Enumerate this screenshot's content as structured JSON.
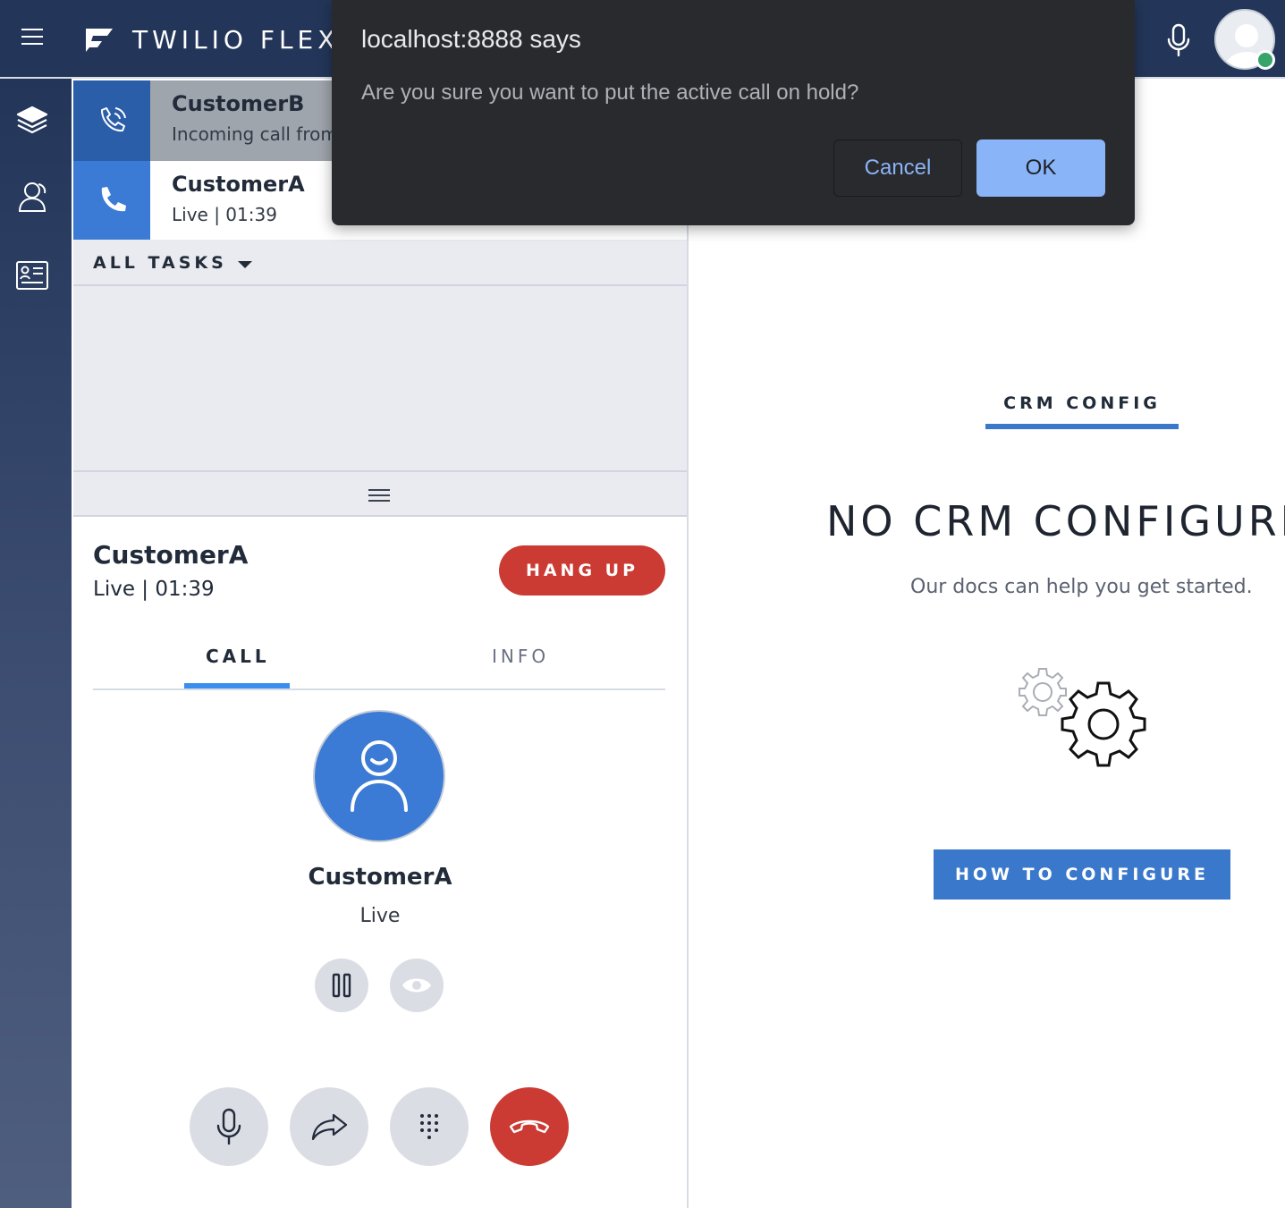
{
  "header": {
    "brand": "TWILIO FLEX",
    "icons": {
      "menu": "hamburger-menu-icon",
      "logo": "twilio-flex-logo",
      "mic": "microphone-icon",
      "avatar": "user-avatar"
    },
    "status_color": "#37a46a",
    "bar_color": "#233659"
  },
  "sidenav": {
    "items": [
      {
        "icon": "layers-icon"
      },
      {
        "icon": "teams-icon"
      },
      {
        "icon": "contacts-card-icon"
      }
    ]
  },
  "tasks": {
    "items": [
      {
        "name": "CustomerB",
        "subtitle": "Incoming call from",
        "icon": "ringing-phone-icon"
      },
      {
        "name": "CustomerA",
        "subtitle": "Live | 01:39",
        "icon": "phone-icon"
      }
    ],
    "filter_label": "ALL TASKS"
  },
  "detail": {
    "name": "CustomerA",
    "status": "Live | 01:39",
    "hangup_label": "HANG UP",
    "tabs": [
      {
        "label": "CALL",
        "active": true
      },
      {
        "label": "INFO",
        "active": false
      }
    ],
    "caller_name": "CustomerA",
    "caller_status": "Live",
    "controls": [
      "hold-icon",
      "monitor-eye-icon"
    ],
    "actions": [
      "microphone-icon",
      "transfer-icon",
      "dialpad-icon",
      "hangup-phone-icon"
    ],
    "accent_color": "#3b7bd6",
    "danger_color": "#cb3a33"
  },
  "crm": {
    "tab_label": "CRM CONFIG",
    "heading": "NO CRM CONFIGURED",
    "subtext": "Our docs can help you get started.",
    "button_label": "HOW TO CONFIGURE",
    "illustration": "gears-icon"
  },
  "dialog": {
    "title": "localhost:8888 says",
    "message": "Are you sure you want to put the active call on hold?",
    "cancel_label": "Cancel",
    "ok_label": "OK"
  }
}
